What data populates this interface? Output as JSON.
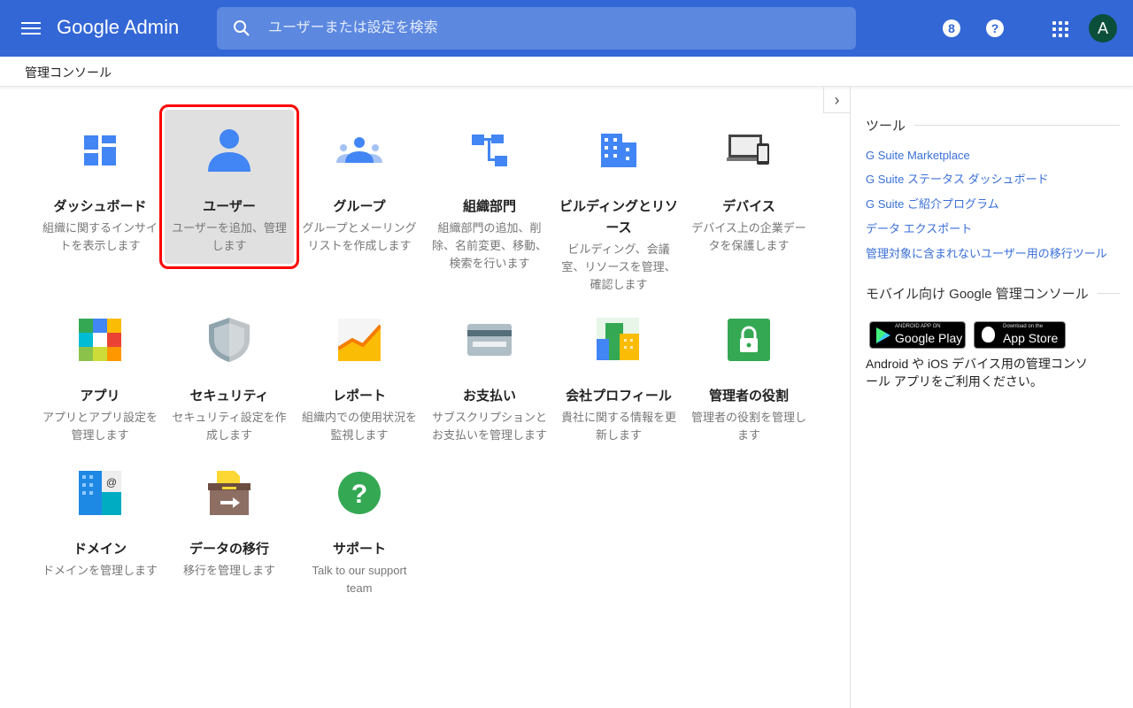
{
  "header": {
    "logo": "Google Admin",
    "search_placeholder": "ユーザーまたは設定を検索",
    "avatar": "A"
  },
  "breadcrumb": "管理コンソール",
  "cards": [
    {
      "title": "ダッシュボード",
      "desc": "組織に関するインサイトを表示します",
      "icon": "dashboard-icon"
    },
    {
      "title": "ユーザー",
      "desc": "ユーザーを追加、管理します",
      "icon": "user-icon"
    },
    {
      "title": "グループ",
      "desc": "グループとメーリングリストを作成します",
      "icon": "group-icon"
    },
    {
      "title": "組織部門",
      "desc": "組織部門の追加、削除、名前変更、移動、検索を行います",
      "icon": "org-units-icon"
    },
    {
      "title": "ビルディングとリソース",
      "desc": "ビルディング、会議室、リソースを管理、確認します",
      "icon": "building-icon"
    },
    {
      "title": "デバイス",
      "desc": "デバイス上の企業データを保護します",
      "icon": "devices-icon"
    },
    {
      "title": "アプリ",
      "desc": "アプリとアプリ設定を管理します",
      "icon": "apps-icon"
    },
    {
      "title": "セキュリティ",
      "desc": "セキュリティ設定を作成します",
      "icon": "shield-icon"
    },
    {
      "title": "レポート",
      "desc": "組織内での使用状況を監視します",
      "icon": "reports-icon"
    },
    {
      "title": "お支払い",
      "desc": "サブスクリプションとお支払いを管理します",
      "icon": "billing-icon"
    },
    {
      "title": "会社プロフィール",
      "desc": "貴社に関する情報を更新します",
      "icon": "company-icon"
    },
    {
      "title": "管理者の役割",
      "desc": "管理者の役割を管理します",
      "icon": "lock-icon"
    },
    {
      "title": "ドメイン",
      "desc": "ドメインを管理します",
      "icon": "domain-icon"
    },
    {
      "title": "データの移行",
      "desc": "移行を管理します",
      "icon": "migration-icon"
    },
    {
      "title": "サポート",
      "desc": "Talk to our support team",
      "icon": "support-icon"
    }
  ],
  "sidebar": {
    "tools_heading": "ツール",
    "links": [
      "G Suite Marketplace",
      "G Suite ステータス ダッシュボード",
      "G Suite ご紹介プログラム",
      "データ エクスポート",
      "管理対象に含まれないユーザー用の移行ツール"
    ],
    "mobile_heading": "モバイル向け Google 管理コンソール",
    "google_play": {
      "small": "ANDROID APP ON",
      "big": "Google Play"
    },
    "app_store": {
      "small": "Download on the",
      "big": "App Store"
    },
    "mobile_text": "Android や iOS デバイス用の管理コンソール アプリをご利用ください。"
  }
}
